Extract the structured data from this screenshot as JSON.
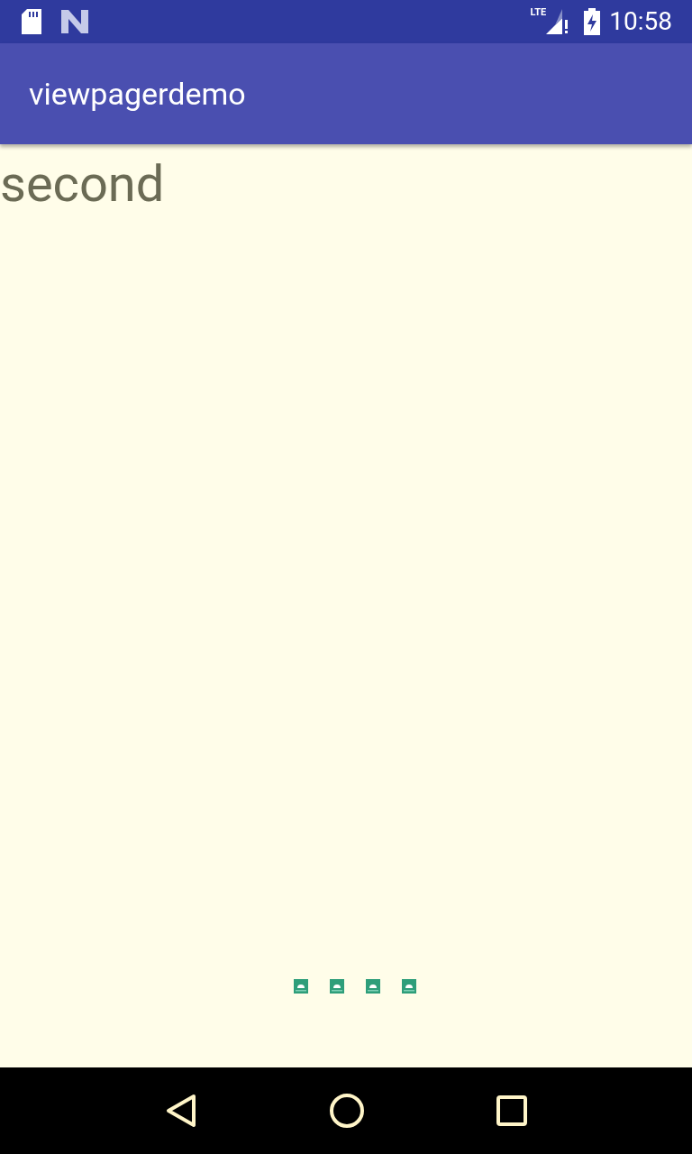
{
  "status_bar": {
    "network": "LTE",
    "time": "10:58"
  },
  "app_bar": {
    "title": "viewpagerdemo"
  },
  "page": {
    "text": "second"
  },
  "indicators": [
    {
      "kind": "image"
    },
    {
      "kind": "image"
    },
    {
      "kind": "image"
    },
    {
      "kind": "image"
    }
  ]
}
